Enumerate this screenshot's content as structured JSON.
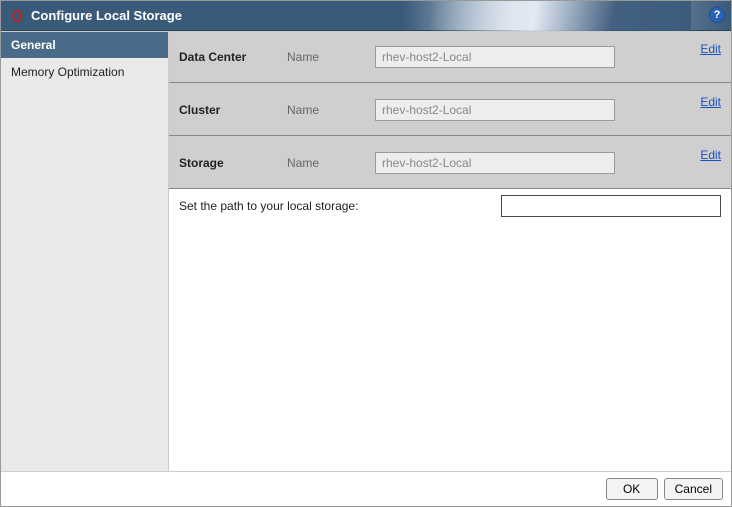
{
  "window": {
    "title": "Configure Local Storage",
    "help_tooltip": "?"
  },
  "sidebar": {
    "items": [
      {
        "label": "General",
        "selected": true
      },
      {
        "label": "Memory Optimization",
        "selected": false
      }
    ]
  },
  "main": {
    "groups": [
      {
        "title": "Data Center",
        "field_label": "Name",
        "value": "rhev-host2-Local",
        "edit_label": "Edit"
      },
      {
        "title": "Cluster",
        "field_label": "Name",
        "value": "rhev-host2-Local",
        "edit_label": "Edit"
      },
      {
        "title": "Storage",
        "field_label": "Name",
        "value": "rhev-host2-Local",
        "edit_label": "Edit"
      }
    ],
    "path_label": "Set the path to your local storage:",
    "path_value": ""
  },
  "footer": {
    "ok_label": "OK",
    "cancel_label": "Cancel"
  }
}
